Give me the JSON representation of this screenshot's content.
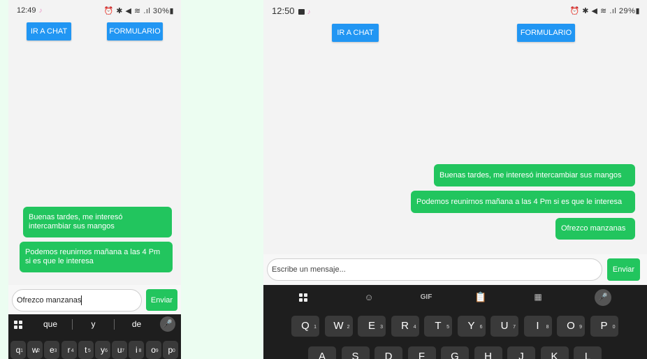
{
  "left": {
    "status": {
      "time": "12:49",
      "right": "⏰ ✱ ◀ ≋ .ıl 30%▮"
    },
    "buttons": {
      "chat": "IR A CHAT",
      "form": "FORMULARIO"
    },
    "messages": [
      "Buenas tardes, me interesó intercambiar sus mangos",
      "Podemos reunirnos mañana a las 4 Pm si es que le interesa"
    ],
    "input_value": "Ofrezco manzanas",
    "send_label": "Enviar",
    "suggestions": [
      "que",
      "y",
      "de"
    ],
    "keys": [
      {
        "k": "q",
        "n": "1"
      },
      {
        "k": "w",
        "n": "2"
      },
      {
        "k": "e",
        "n": "3"
      },
      {
        "k": "r",
        "n": "4"
      },
      {
        "k": "t",
        "n": "5"
      },
      {
        "k": "y",
        "n": "6"
      },
      {
        "k": "u",
        "n": "7"
      },
      {
        "k": "i",
        "n": "8"
      },
      {
        "k": "o",
        "n": "9"
      },
      {
        "k": "p",
        "n": "0"
      }
    ]
  },
  "right": {
    "status": {
      "time": "12:50",
      "right": "⏰ ✱ ◀ ≋ .ıl 29%▮"
    },
    "buttons": {
      "chat": "IR A CHAT",
      "form": "FORMULARIO"
    },
    "messages": [
      "Buenas tardes, me interesó intercambiar sus mangos",
      "Podemos reunirnos mañana a las 4 Pm si es que le interesa",
      "Ofrezco manzanas"
    ],
    "input_placeholder": "Escribe un mensaje...",
    "send_label": "Enviar",
    "toolbar": {
      "gif": "GIF"
    },
    "row1": [
      {
        "k": "Q",
        "n": "1"
      },
      {
        "k": "W",
        "n": "2"
      },
      {
        "k": "E",
        "n": "3"
      },
      {
        "k": "R",
        "n": "4"
      },
      {
        "k": "T",
        "n": "5"
      },
      {
        "k": "Y",
        "n": "6"
      },
      {
        "k": "U",
        "n": "7"
      },
      {
        "k": "I",
        "n": "8"
      },
      {
        "k": "O",
        "n": "9"
      },
      {
        "k": "P",
        "n": "0"
      }
    ],
    "row2": [
      "A",
      "S",
      "D",
      "F",
      "G",
      "H",
      "J",
      "K",
      "L"
    ]
  },
  "colors": {
    "accent_blue": "#2196f3",
    "bubble_green": "#22c55e",
    "keyboard_bg": "#1e1e1e"
  }
}
